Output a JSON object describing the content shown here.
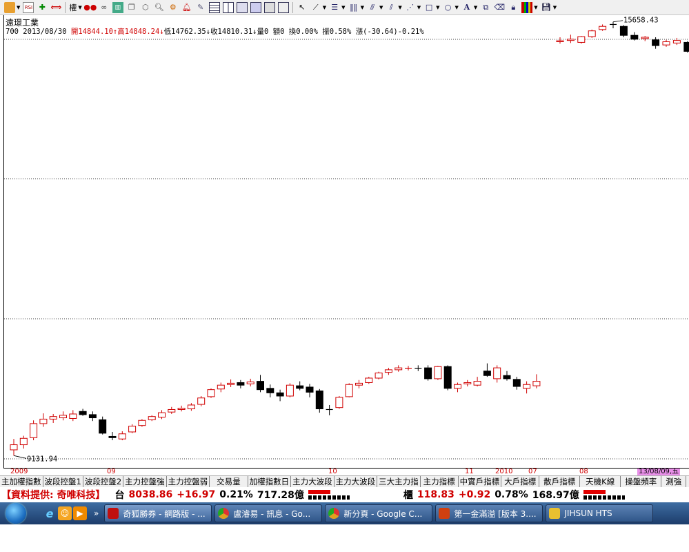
{
  "toolbar": {
    "icons": [
      "folder-icon",
      "rsi-icon",
      "move-icon",
      "stretch-icon",
      "weight-dropdown",
      "eye-red-icon",
      "eye-icon",
      "chart-type-icon",
      "copy-icon",
      "cube-icon",
      "magnifier-icon",
      "zoom-icon",
      "alarm-icon",
      "pen-icon",
      "layout-a-icon",
      "layout-b-icon",
      "layout-c-icon",
      "layout-d-icon",
      "layout-e-icon",
      "layout-f-icon"
    ],
    "weight_label": "權",
    "draw_tools": [
      "pointer-icon",
      "line-icon",
      "hline-icon",
      "vline-icon",
      "fan-icon",
      "parallel-icon",
      "fib-icon",
      "rect-icon",
      "ellipse-icon",
      "text-icon",
      "copy-draw-icon",
      "eraser-icon",
      "lock-icon",
      "color-icon",
      "save-icon"
    ],
    "text_tool_label": "A"
  },
  "stock": {
    "name": "遠璟工業",
    "code": "700",
    "date": "2013/08/30",
    "open_label": "開14844.10↑",
    "high_label": "高14848.24↓",
    "low_label": "低14762.35↓",
    "close_label": "收14810.31↓",
    "volume_label": "量0",
    "amount_label": "額0",
    "turnover_label": "換0.00%",
    "amplitude_label": "振0.58%",
    "change_label": "漲(-30.64)-0.21%"
  },
  "chart_data": {
    "type": "candlestick",
    "max_label": "15658.43",
    "min_label": "9131.94",
    "ylim": [
      9131.94,
      15658.43
    ],
    "colors": {
      "up": "#d00000",
      "down": "#000000"
    },
    "candles": [
      [
        9240,
        9410,
        9150,
        9320
      ],
      [
        9320,
        9460,
        9260,
        9420
      ],
      [
        9430,
        9700,
        9390,
        9650
      ],
      [
        9650,
        9810,
        9600,
        9720
      ],
      [
        9720,
        9800,
        9660,
        9760
      ],
      [
        9740,
        9840,
        9700,
        9780
      ],
      [
        9730,
        9860,
        9690,
        9800
      ],
      [
        9840,
        9880,
        9770,
        9790
      ],
      [
        9790,
        9840,
        9690,
        9740
      ],
      [
        9710,
        9760,
        9480,
        9500
      ],
      [
        9450,
        9520,
        9390,
        9430
      ],
      [
        9410,
        9530,
        9390,
        9490
      ],
      [
        9520,
        9640,
        9500,
        9610
      ],
      [
        9620,
        9720,
        9600,
        9700
      ],
      [
        9710,
        9780,
        9690,
        9760
      ],
      [
        9750,
        9860,
        9720,
        9820
      ],
      [
        9830,
        9910,
        9800,
        9870
      ],
      [
        9870,
        9930,
        9840,
        9890
      ],
      [
        9880,
        9970,
        9850,
        9940
      ],
      [
        9950,
        10080,
        9920,
        10050
      ],
      [
        10070,
        10200,
        10050,
        10180
      ],
      [
        10190,
        10290,
        10140,
        10250
      ],
      [
        10260,
        10340,
        10220,
        10280
      ],
      [
        10290,
        10330,
        10200,
        10250
      ],
      [
        10270,
        10350,
        10230,
        10300
      ],
      [
        10310,
        10410,
        10140,
        10180
      ],
      [
        10200,
        10260,
        10060,
        10130
      ],
      [
        10130,
        10180,
        10000,
        10080
      ],
      [
        10080,
        10280,
        10060,
        10250
      ],
      [
        10240,
        10310,
        10170,
        10200
      ],
      [
        10220,
        10270,
        10060,
        10140
      ],
      [
        10160,
        10190,
        9820,
        9880
      ],
      [
        9870,
        9940,
        9780,
        9860
      ],
      [
        9900,
        10080,
        9880,
        10060
      ],
      [
        10070,
        10280,
        10060,
        10260
      ],
      [
        10250,
        10330,
        10200,
        10280
      ],
      [
        10290,
        10380,
        10270,
        10360
      ],
      [
        10360,
        10460,
        10340,
        10440
      ],
      [
        10450,
        10520,
        10410,
        10490
      ],
      [
        10490,
        10560,
        10460,
        10520
      ],
      [
        10500,
        10550,
        10480,
        10510
      ],
      [
        10510,
        10560,
        10470,
        10500
      ],
      [
        10520,
        10560,
        10320,
        10350
      ],
      [
        10350,
        10550,
        10330,
        10540
      ],
      [
        10540,
        10560,
        10170,
        10200
      ],
      [
        10200,
        10290,
        10140,
        10260
      ],
      [
        10270,
        10330,
        10230,
        10290
      ],
      [
        10250,
        10380,
        10230,
        10310
      ],
      [
        10470,
        10590,
        10380,
        10400
      ],
      [
        10350,
        10560,
        10290,
        10520
      ],
      [
        10400,
        10470,
        10320,
        10350
      ],
      [
        10340,
        10380,
        10180,
        10230
      ],
      [
        10200,
        10310,
        10120,
        10260
      ],
      [
        10240,
        10420,
        10200,
        10310
      ],
      [
        15610,
        15680,
        15580,
        15625
      ],
      [
        15630,
        15720,
        15590,
        15650
      ],
      [
        15600,
        15700,
        15580,
        15690
      ],
      [
        15690,
        15800,
        15670,
        15780
      ],
      [
        15800,
        15880,
        15780,
        15850
      ],
      [
        15880,
        15920,
        15820,
        15870
      ],
      [
        15850,
        15870,
        15680,
        15710
      ],
      [
        15710,
        15760,
        15630,
        15650
      ],
      [
        15660,
        15700,
        15620,
        15680
      ],
      [
        15640,
        15680,
        15500,
        15550
      ],
      [
        15560,
        15640,
        15530,
        15610
      ],
      [
        15590,
        15670,
        15560,
        15630
      ],
      [
        15600,
        15620,
        15440,
        15460
      ],
      [
        15420,
        15440,
        15100,
        15150
      ]
    ]
  },
  "time_axis": [
    "2009",
    "09",
    "10",
    "11",
    "2010",
    "07",
    "08",
    "13/08/09,五"
  ],
  "tabs": [
    "主加權指數",
    "波段控盤1",
    "波段控盤2",
    "主力控盤強",
    "主力控盤弱",
    "交易量",
    "加權指數日",
    "主力大波段",
    "主力大波段",
    "三大主力指",
    "主力指標",
    "中實戶指標",
    "大戶指標",
    "散戶指標",
    "天機K線",
    "操盤頻率",
    "測強"
  ],
  "ticker": {
    "provider": "【資料提供: 奇唯科技】",
    "twse_label": "台",
    "twse_index": "8038.86",
    "twse_change": "+16.97",
    "twse_pct": "0.21%",
    "twse_volume": "717.28億",
    "otc_label": "櫃",
    "otc_index": "118.83",
    "otc_change": "+0.92",
    "otc_pct": "0.78%",
    "otc_volume": "168.97億"
  },
  "taskbar": {
    "overflow": "»",
    "items": [
      {
        "label": "奇狐勝券 - 網路版 - ...",
        "color": "#c01010"
      },
      {
        "label": "盧濬易 - 訊息 - Go...",
        "color": "#e0a020"
      },
      {
        "label": "新分頁 - Google C...",
        "color": "#e0a020"
      },
      {
        "label": "第一金滿溢 [版本 3....",
        "color": "#d04010"
      },
      {
        "label": "JIHSUN HTS",
        "color": "#e8c030"
      }
    ]
  }
}
